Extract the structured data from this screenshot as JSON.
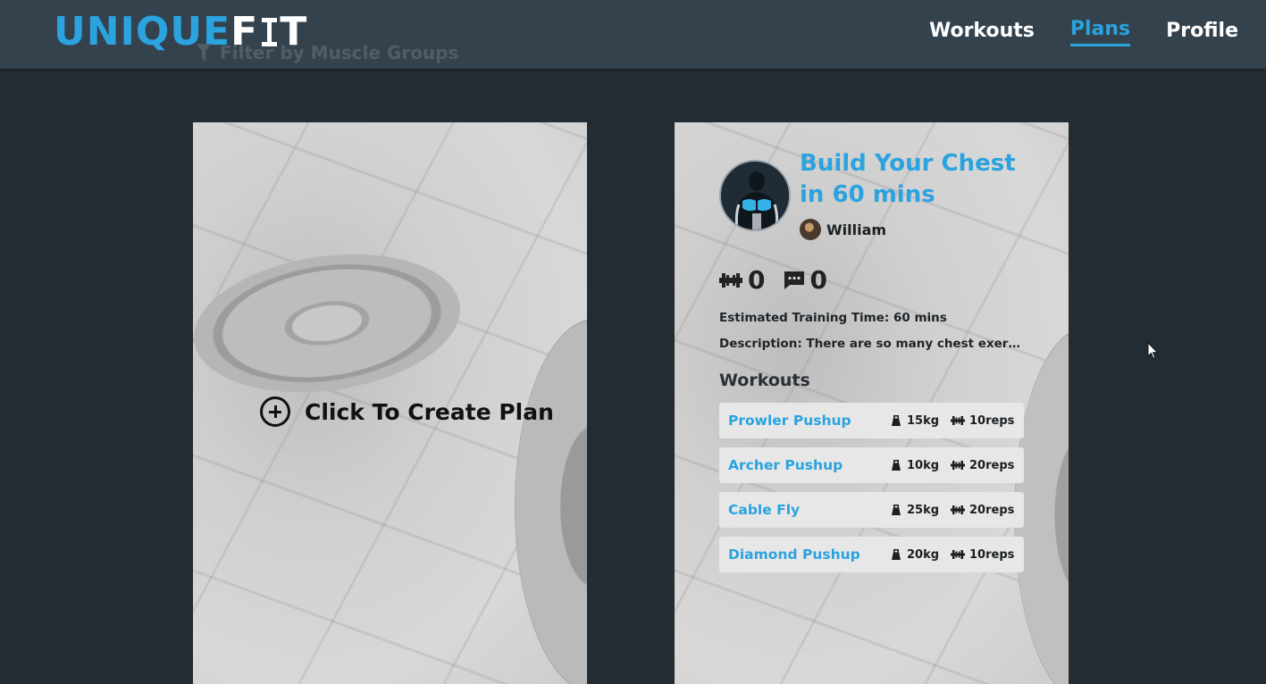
{
  "header": {
    "logo_part1": "UNIQUE",
    "logo_part2_a": "F",
    "logo_part2_b": "T",
    "nav": [
      {
        "label": "Workouts",
        "active": false
      },
      {
        "label": "Plans",
        "active": true
      },
      {
        "label": "Profile",
        "active": false
      }
    ]
  },
  "filter": {
    "label": "Filter by Muscle Groups",
    "icon": "funnel-icon"
  },
  "create_card": {
    "label": "Click To Create Plan",
    "icon": "plus-circle-icon"
  },
  "plan_card": {
    "title": "Build Your Chest in 60 mins",
    "author": "William",
    "workout_count": "0",
    "comment_count": "0",
    "estimated_time": "Estimated Training Time: 60 mins",
    "description": "Description: There are so many chest exercises an...",
    "workouts_heading": "Workouts",
    "workouts": [
      {
        "name": "Prowler Pushup",
        "weight": "15kg",
        "reps": "10reps"
      },
      {
        "name": "Archer Pushup",
        "weight": "10kg",
        "reps": "20reps"
      },
      {
        "name": "Cable Fly",
        "weight": "25kg",
        "reps": "20reps"
      },
      {
        "name": "Diamond Pushup",
        "weight": "20kg",
        "reps": "10reps"
      }
    ]
  },
  "colors": {
    "background": "#232c33",
    "header": "#34424e",
    "accent": "#2aa3df"
  }
}
